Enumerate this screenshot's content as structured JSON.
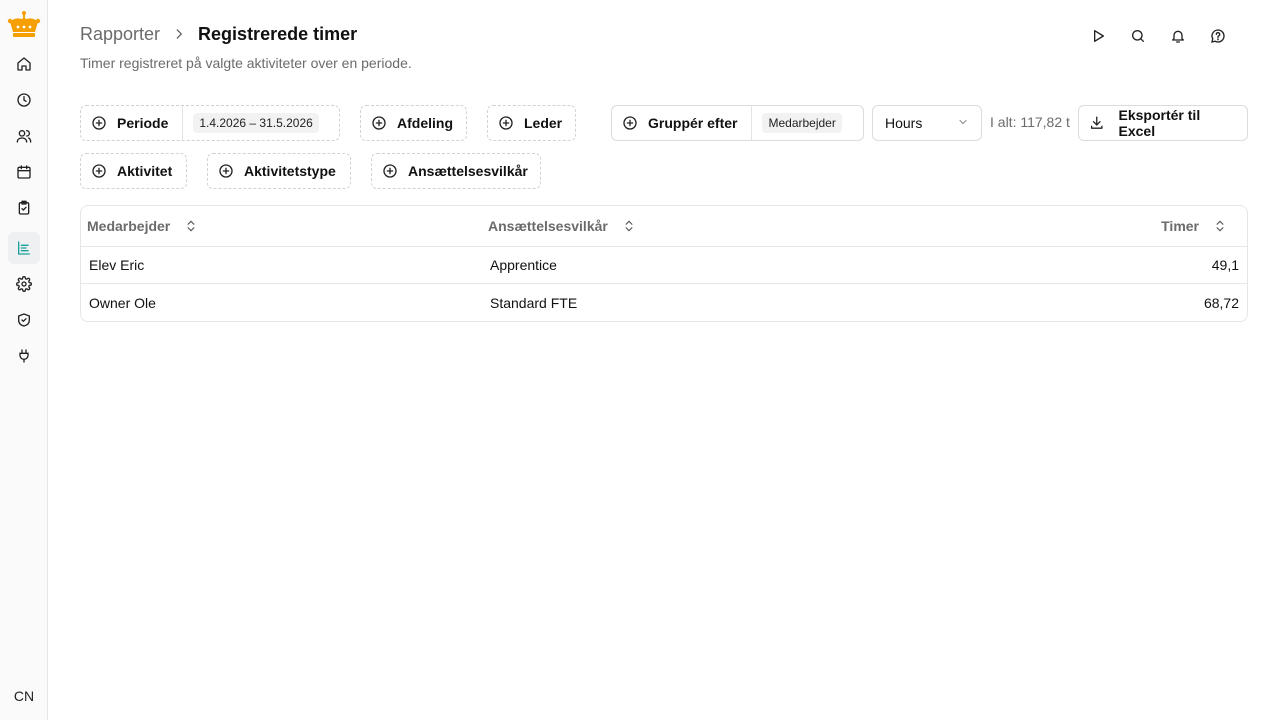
{
  "colors": {
    "brand": "#f5a000",
    "active_nav": "#1aa0a0"
  },
  "sidebar": {
    "items": [
      {
        "icon": "home-icon"
      },
      {
        "icon": "clock-icon"
      },
      {
        "icon": "users-icon"
      },
      {
        "icon": "calendar-icon"
      },
      {
        "icon": "clipboard-check-icon"
      },
      {
        "icon": "reports-icon",
        "active": true
      },
      {
        "icon": "gear-icon"
      },
      {
        "icon": "shield-check-icon"
      },
      {
        "icon": "plug-icon"
      }
    ],
    "avatar": "CN"
  },
  "header": {
    "breadcrumb_parent": "Rapporter",
    "title": "Registrerede timer",
    "subtitle": "Timer registreret på valgte aktiviteter over en periode."
  },
  "filters": {
    "periode_label": "Periode",
    "periode_value": "1.4.2026 – 31.5.2026",
    "afdeling_label": "Afdeling",
    "leder_label": "Leder",
    "group_label": "Gruppér efter",
    "group_value": "Medarbejder",
    "unit_value": "Hours",
    "total": "I alt: 117,82 t",
    "export_label": "Eksportér til Excel",
    "aktivitet_label": "Aktivitet",
    "aktivitetstype_label": "Aktivitetstype",
    "ansaettelse_label": "Ansættelsesvilkår"
  },
  "table": {
    "headers": [
      "Medarbejder",
      "Ansættelsesvilkår",
      "Timer"
    ],
    "rows": [
      [
        "Elev Eric",
        "Apprentice",
        "49,1"
      ],
      [
        "Owner Ole",
        "Standard FTE",
        "68,72"
      ]
    ]
  }
}
